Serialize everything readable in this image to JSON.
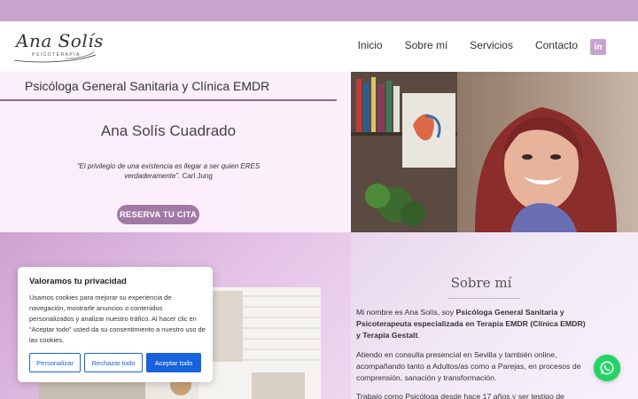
{
  "header": {
    "logo_script": "Ana Solís",
    "logo_sub": "PSICOTERAPIA",
    "nav": [
      "Inicio",
      "Sobre mí",
      "Servicios",
      "Contacto"
    ],
    "linkedin_label": "in"
  },
  "hero": {
    "subtitle": "Psicóloga General Sanitaria y Clínica EMDR",
    "name": "Ana Solís Cuadrado",
    "quote_text": "“El privilegio de una existencia es llegar a ser quien ERES verdaderamente”.",
    "quote_author": " Carl Jung",
    "cta": "RESERVA TU CITA"
  },
  "about": {
    "title": "Sobre mí",
    "p1_intro": "Mi nombre es Ana Solís, soy ",
    "p1_bold": "Psicóloga General Sanitaria y Psicoterapeuta especializada en Terapia EMDR  (Clínica EMDR) y Terapia Gestalt",
    "p1_end": ".",
    "p2": "Atiendo en consulta presencial en Sevilla y también online, acompañando tanto a Adultos/as como a Parejas, en procesos de comprensión, sanación y transformación.",
    "p3": "Trabajo como Psicóloga desde hace 17 años y ser testigo de"
  },
  "cookie": {
    "title": "Valoramos tu privacidad",
    "text": "Usamos cookies para mejorar su experiencia de navegación, mostrarle anuncios o contenidos personalizados y analizar nuestro tráfico. Al hacer clic en “Aceptar todo” usted da su consentimiento a nuestro uso de las cookies.",
    "btn_customize": "Personalizar",
    "btn_reject": "Rechazar todo",
    "btn_accept": "Aceptar todo"
  },
  "colors": {
    "topbar": "#c9a2cf",
    "cta": "#a07aa5",
    "cookie_accent": "#1863dc",
    "whatsapp": "#25d366"
  },
  "icons": {
    "linkedin": "linkedin-icon",
    "whatsapp": "whatsapp-icon"
  }
}
